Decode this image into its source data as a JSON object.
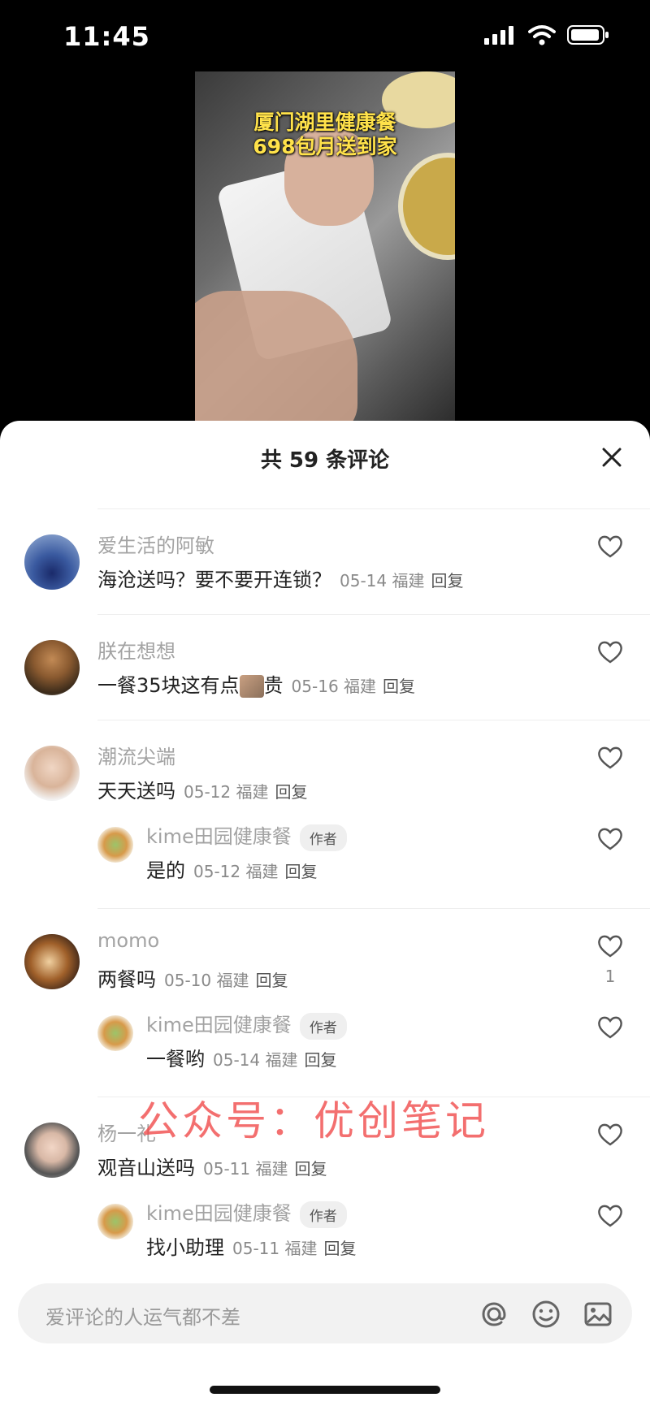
{
  "status_bar": {
    "time": "11:45"
  },
  "video": {
    "caption_line1": "厦门湖里健康餐",
    "caption_line2": "698包月送到家"
  },
  "sheet": {
    "title": "共 59 条评论"
  },
  "comments": [
    {
      "name": "爱生活的阿敏",
      "text": "海沧送吗？要不要开连锁？",
      "date": "05-14",
      "region": "福建",
      "reply": "回复"
    },
    {
      "name": "朕在想想",
      "text_before": "一餐35块这有点",
      "text_after": "贵",
      "date": "05-16",
      "region": "福建",
      "reply": "回复"
    },
    {
      "name": "潮流尖端",
      "text": "天天送吗",
      "date": "05-12",
      "region": "福建",
      "reply": "回复",
      "sub": {
        "name": "kime田园健康餐",
        "tag": "作者",
        "text": "是的",
        "date": "05-12",
        "region": "福建",
        "reply": "回复"
      }
    },
    {
      "name": "momo",
      "text": "两餐吗",
      "date": "05-10",
      "region": "福建",
      "reply": "回复",
      "likes": "1",
      "sub": {
        "name": "kime田园健康餐",
        "tag": "作者",
        "text": "一餐哟",
        "date": "05-14",
        "region": "福建",
        "reply": "回复"
      }
    },
    {
      "name": "杨一礼",
      "text": "观音山送吗",
      "date": "05-11",
      "region": "福建",
      "reply": "回复",
      "sub": {
        "name": "kime田园健康餐",
        "tag": "作者",
        "text": "找小助理",
        "date": "05-11",
        "region": "福建",
        "reply": "回复"
      }
    }
  ],
  "watermark": "公众号：优创笔记",
  "input": {
    "placeholder": "爱评论的人运气都不差"
  },
  "icons": [
    "signal-icon",
    "wifi-icon",
    "battery-icon",
    "close-icon",
    "heart-icon",
    "at-icon",
    "emoji-icon",
    "image-icon"
  ]
}
